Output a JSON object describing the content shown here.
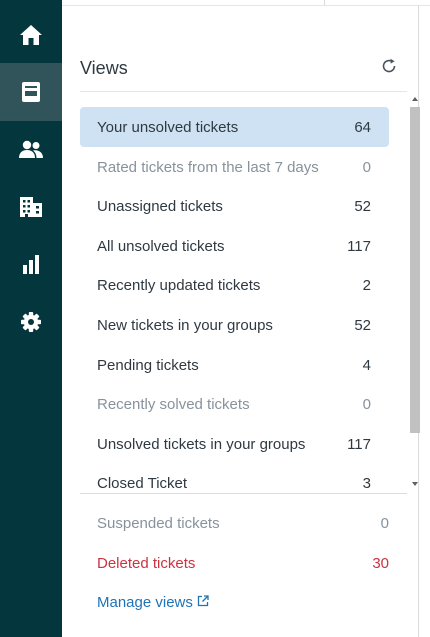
{
  "nav": {
    "items": [
      {
        "icon": "home-icon",
        "active": false
      },
      {
        "icon": "views-icon",
        "active": true
      },
      {
        "icon": "customers-icon",
        "active": false
      },
      {
        "icon": "organizations-icon",
        "active": false
      },
      {
        "icon": "reporting-icon",
        "active": false
      },
      {
        "icon": "settings-icon",
        "active": false
      }
    ],
    "background": "#03363d",
    "active_background": "#30545a"
  },
  "views": {
    "title": "Views",
    "refresh_icon": "refresh-icon",
    "items": [
      {
        "label": "Your unsolved tickets",
        "count": "64",
        "active": true,
        "muted": false
      },
      {
        "label": "Rated tickets from the last 7 days",
        "count": "0",
        "active": false,
        "muted": true
      },
      {
        "label": "Unassigned tickets",
        "count": "52",
        "active": false,
        "muted": false
      },
      {
        "label": "All unsolved tickets",
        "count": "117",
        "active": false,
        "muted": false
      },
      {
        "label": "Recently updated tickets",
        "count": "2",
        "active": false,
        "muted": false
      },
      {
        "label": "New tickets in your groups",
        "count": "52",
        "active": false,
        "muted": false
      },
      {
        "label": "Pending tickets",
        "count": "4",
        "active": false,
        "muted": false
      },
      {
        "label": "Recently solved tickets",
        "count": "0",
        "active": false,
        "muted": true
      },
      {
        "label": "Unsolved tickets in your groups",
        "count": "117",
        "active": false,
        "muted": false
      },
      {
        "label": "Closed Ticket",
        "count": "3",
        "active": false,
        "muted": false
      }
    ],
    "footer": {
      "suspended": {
        "label": "Suspended tickets",
        "count": "0"
      },
      "deleted": {
        "label": "Deleted tickets",
        "count": "30"
      },
      "manage": {
        "label": "Manage views",
        "icon": "external-link-icon"
      }
    }
  },
  "colors": {
    "active_row": "#cfe2f3",
    "muted_text": "#87929d",
    "deleted_text": "#cc3340",
    "link": "#1f73b7"
  }
}
